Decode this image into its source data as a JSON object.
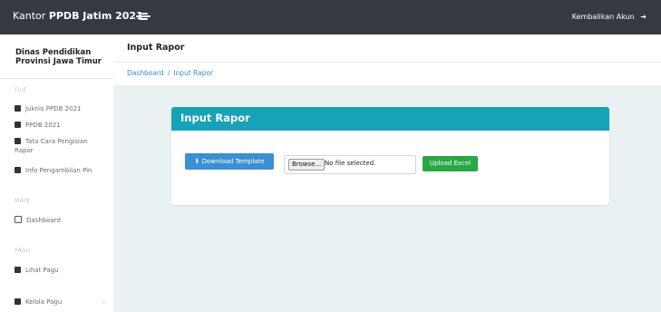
{
  "topbar": {
    "brand_prefix": "Kantor",
    "brand_bold": "PPDB Jatim 2021",
    "menu_icon": "hamburger-icon",
    "account_label": "Kembalikan Akun",
    "account_icon": "sign-out-icon"
  },
  "sidebar": {
    "title": "Dinas Pendidikan Provinsi Jawa Timur",
    "sections": [
      {
        "label": "FILE",
        "items": [
          {
            "label": "Juknis PPDB 2021",
            "icon": "book-icon"
          },
          {
            "label": "PPDB 2021",
            "icon": "book-icon"
          },
          {
            "label": "Tata Cara Pengisian Rapor",
            "icon": "book-icon"
          },
          {
            "label": "Info Pengambilan Pin",
            "icon": "book-icon"
          }
        ]
      },
      {
        "label": "MAIN",
        "items": [
          {
            "label": "Dashboard",
            "icon": "home-icon"
          }
        ]
      },
      {
        "label": "PAGU",
        "items": [
          {
            "label": "Lihat Pagu",
            "icon": "table-icon"
          },
          {
            "label": "Kelola Pagu",
            "icon": "clipboard-icon",
            "chevron": "‹"
          }
        ]
      }
    ]
  },
  "header": {
    "title": "Input Rapor"
  },
  "breadcrumb": {
    "items": [
      "Dashboard",
      "Input Rapor"
    ],
    "separator": "/"
  },
  "card": {
    "title": "Input Rapor",
    "download_label": "Download Template",
    "download_icon": "download-icon",
    "browse_label": "Browse...",
    "file_status": "No file selected.",
    "upload_label": "Upload Excel"
  },
  "colors": {
    "topbar": "#343a40",
    "card_header": "#17a2b8",
    "download_button": "#3b8fd3",
    "upload_button": "#28a745",
    "main_background": "#e9f1f3"
  }
}
